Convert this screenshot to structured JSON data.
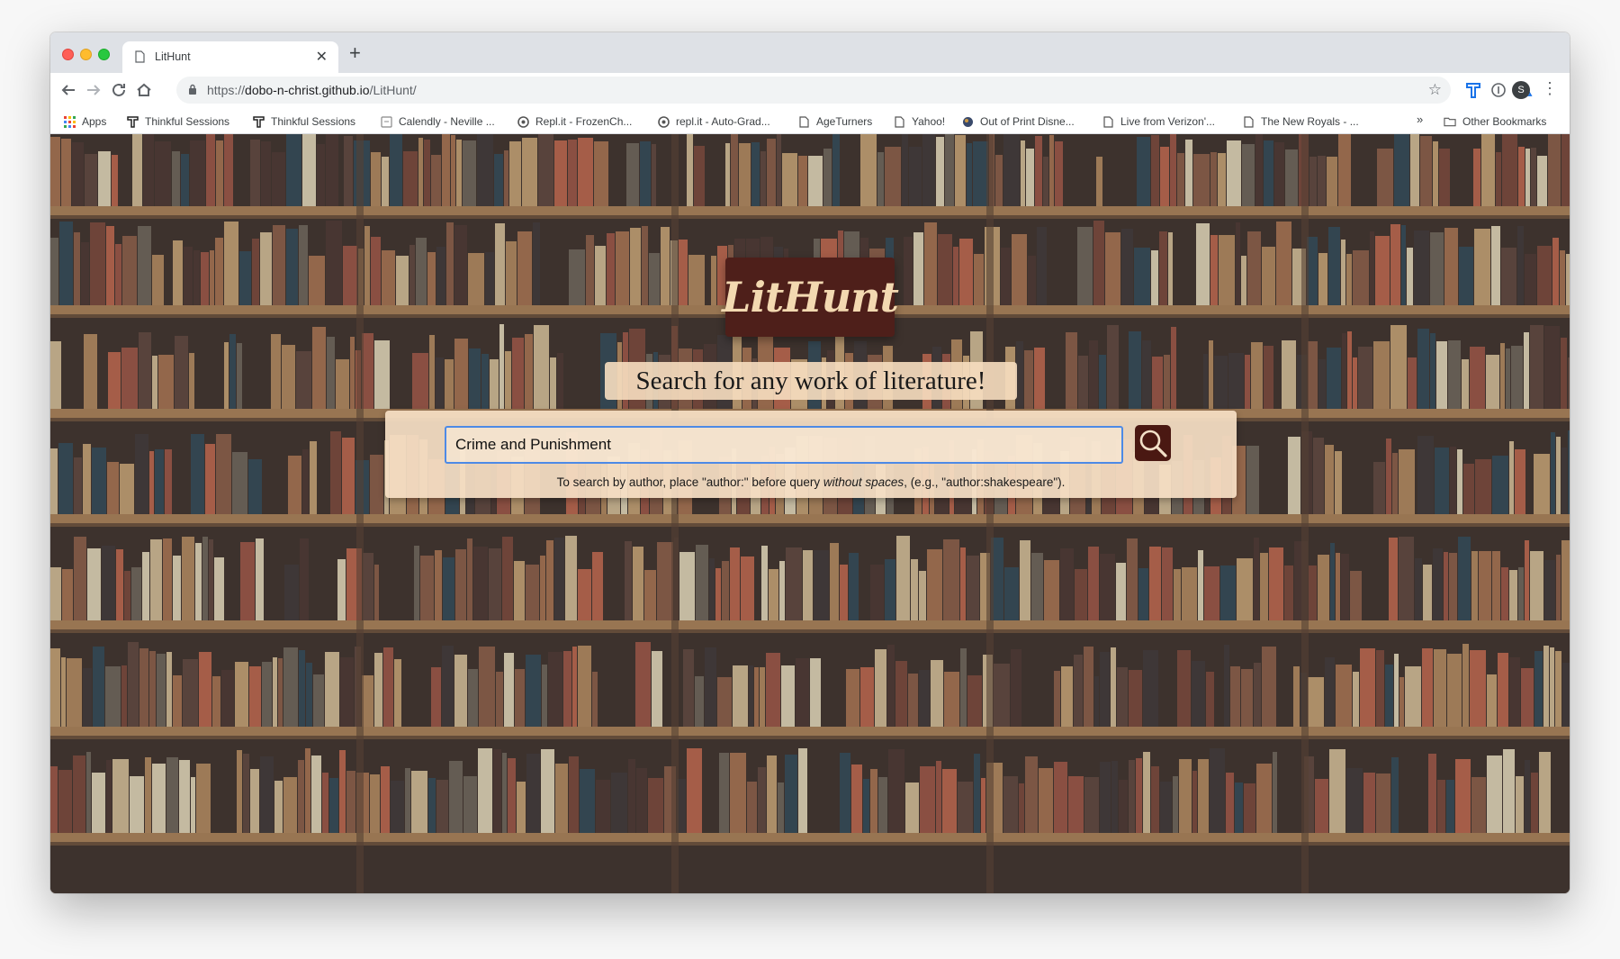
{
  "browser": {
    "tab_title": "LitHunt",
    "url_scheme": "https://",
    "url_host": "dobo-n-christ.github.io",
    "url_path": "/LitHunt/",
    "profile_initial": "S"
  },
  "bookmarks": [
    {
      "label": "Apps",
      "icon": "apps-grid-icon"
    },
    {
      "label": "Thinkful Sessions",
      "icon": "thinkful-icon"
    },
    {
      "label": "Thinkful Sessions",
      "icon": "thinkful-icon"
    },
    {
      "label": "Calendly - Neville ...",
      "icon": "calendly-icon"
    },
    {
      "label": "Repl.it - FrozenCh...",
      "icon": "replit-icon"
    },
    {
      "label": "repl.it - Auto-Grad...",
      "icon": "replit-icon"
    },
    {
      "label": "AgeTurners",
      "icon": "page-icon"
    },
    {
      "label": "Yahoo!",
      "icon": "page-icon"
    },
    {
      "label": "Out of Print Disne...",
      "icon": "disney-icon"
    },
    {
      "label": "Live from Verizon'...",
      "icon": "page-icon"
    },
    {
      "label": "The New Royals - ...",
      "icon": "page-icon"
    }
  ],
  "other_bookmarks": "Other Bookmarks",
  "overflow": "»",
  "app": {
    "logo_text": "LitHunt",
    "tagline": "Search for any work of literature!",
    "search_value": "Crime and Punishment",
    "hint_before": "To search by author, place \"author:\" before query ",
    "hint_em": "without spaces",
    "hint_after": ", (e.g., \"author:shakespeare\")."
  },
  "colors": {
    "logo_bg": "#4e1f1a",
    "logo_text": "#f3d9b1",
    "panel_bg": "#f6e0c6",
    "search_border": "#4d8ae6",
    "search_button": "#4a1812"
  }
}
